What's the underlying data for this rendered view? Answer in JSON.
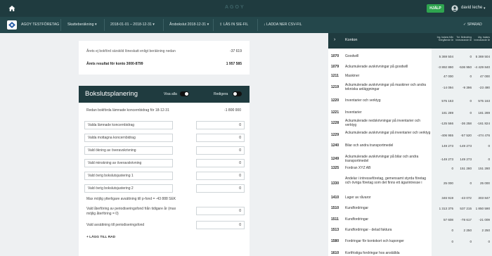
{
  "topbar": {
    "logo_text": "AGOY",
    "help_label": "HJÄLP",
    "user_name": "david leche"
  },
  "toolbar": {
    "company": "AGOY TESTFÖRETAG",
    "tax_calc": "Skatteberäkning",
    "period": "2018-01-01 – 2018-12-31",
    "closing": "Årsbokslut 2018-12-31",
    "import_sie": "LÄS IN SIE-FIL",
    "download_csv": "LADDA NER CSV-FIL",
    "saved": "SPARAD"
  },
  "summary": {
    "row1_label": "Årets ej bokförd särskild löneskatt enligt beräkning nedan",
    "row1_value": "-37 619",
    "row2_label": "Årets resultat för konto 3000-8799",
    "row2_value": "1 957 585"
  },
  "bokslut": {
    "title": "Bokslutsplanering",
    "show_all": "Visa alla",
    "edit": "Redigera",
    "booked_label": "Redan bokförda lämnade koncernbidrag för 18-12-31",
    "booked_value": "-1 800 000",
    "rows": [
      {
        "label": "Valda lämnade koncernbidrag",
        "value": "0"
      },
      {
        "label": "Valda mottagna koncernbidrag",
        "value": "0"
      },
      {
        "label": "Vald ökning av överavskrivning",
        "value": "0"
      },
      {
        "label": "Vald minskning av överavskrivning",
        "value": "0"
      },
      {
        "label": "Vald övrig bokslutsjustering 1",
        "value": "0"
      },
      {
        "label": "Vald övrig bokslutsjustering 2",
        "value": "0"
      }
    ],
    "max_label": "Max möjlig ytterligare avsättning till p-fond = -43 888 SEK",
    "reversal_label": "Vald återföring av periodiseringsfond från tidigare år (max möjlig återföring = 0)",
    "reversal_value": "0",
    "allocation_label": "Vald avsättning till periodiseringsfond",
    "allocation_value": "0",
    "add_row": "+ LÄGG TILL RAD"
  },
  "accounts": {
    "title": "Konton",
    "col1": "Ing. balans från föregående år",
    "col2": "Tot. förändring innevarande år",
    "col3": "Utg. balans innevarande år",
    "rows": [
      {
        "acc": "1070",
        "name": "Goodwill",
        "v1": "5 369 504",
        "v2": "0",
        "v3": "5 369 504"
      },
      {
        "acc": "1079",
        "name": "Ackumulerade avskrivningar på goodwill",
        "v1": "-3 892 890",
        "v2": "-536 950",
        "v3": "-4 429 840"
      },
      {
        "acc": "1211",
        "name": "Maskiner",
        "v1": "47 000",
        "v2": "0",
        "v3": "47 000"
      },
      {
        "acc": "1219",
        "name": "Ackumulerade avskrivningar på maskiner och andra tekniska anläggningar",
        "v1": "-14 094",
        "v2": "-9 396",
        "v3": "-23 490"
      },
      {
        "acc": "1220",
        "name": "Inventarier och verktyg",
        "v1": "575 163",
        "v2": "0",
        "v3": "575 163"
      },
      {
        "acc": "1221",
        "name": "Inventarier",
        "v1": "181 289",
        "v2": "0",
        "v3": "181 289"
      },
      {
        "acc": "1228",
        "name": "Ackumulerade nedskrivningar på inventarier och verktyg",
        "v1": "-125 566",
        "v2": "-36 258",
        "v3": "-161 824"
      },
      {
        "acc": "1229",
        "name": "Ackumulerade avskrivningar på inventarier och verktyg",
        "v1": "-406 955",
        "v2": "-57 520",
        "v3": "-474 476"
      },
      {
        "acc": "1240",
        "name": "Bilar och andra transportmedel",
        "v1": "149 273",
        "v2": "-149 273",
        "v3": "0"
      },
      {
        "acc": "1249",
        "name": "Ackumulerade avskrivningar på bilar och andra transportmedel",
        "v1": "-149 273",
        "v2": "149 273",
        "v3": "0"
      },
      {
        "acc": "1325",
        "name": "Fordran XYZ AB",
        "v1": "0",
        "v2": "151 280",
        "v3": "151 280"
      },
      {
        "acc": "1330",
        "name": "Andelar i intresseföretag, gemensamt styrda företag och övriga företag som det finns ett ägarintresse i",
        "v1": "25 000",
        "v2": "0",
        "v3": "25 000"
      },
      {
        "acc": "1410",
        "name": "Lager av råvaror",
        "v1": "346 919",
        "v2": "-43 072",
        "v3": "303 847"
      },
      {
        "acc": "1510",
        "name": "Kundfordringar",
        "v1": "1 313 375",
        "v2": "537 215",
        "v3": "1 850 590"
      },
      {
        "acc": "1511",
        "name": "Kundfordringar",
        "v1": "57 608",
        "v2": "-78 617",
        "v3": "-21 009"
      },
      {
        "acc": "1513",
        "name": "Kundfordringar - delad faktura",
        "v1": "0",
        "v2": "2 250",
        "v3": "2 250"
      },
      {
        "acc": "1580",
        "name": "Fordringar för kontokort och kuponger",
        "v1": "0",
        "v2": "0",
        "v3": "0"
      },
      {
        "acc": "1610",
        "name": "Kortfristiga fordringar hos anställda",
        "v1": "",
        "v2": "",
        "v3": ""
      }
    ]
  }
}
